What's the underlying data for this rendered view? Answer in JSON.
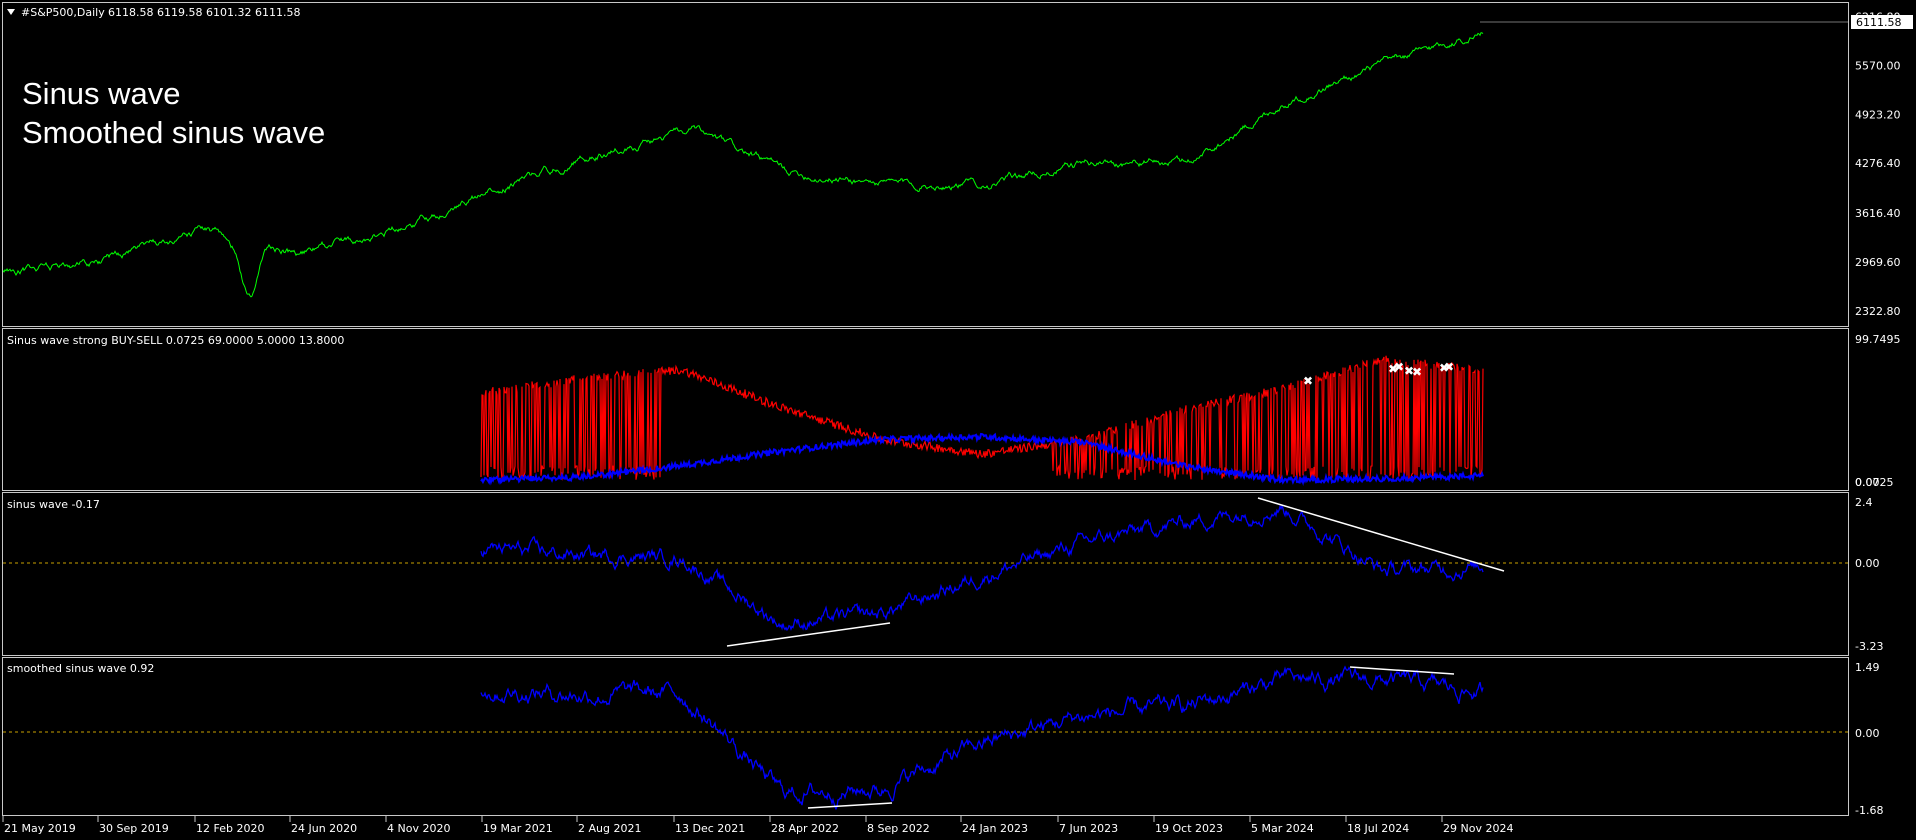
{
  "header": {
    "symbol": "#S&P500,Daily",
    "ohlc": "6118.58 6119.58 6101.32 6111.58",
    "last_price": "6111.58"
  },
  "overlay_text": [
    "Sinus wave",
    "Smoothed sinus wave"
  ],
  "colors": {
    "price_line": "#00ff00",
    "indicator_red": "#ff0000",
    "indicator_blue": "#0000ff",
    "trendline": "#ffffff",
    "zero_level": "#c8a000",
    "background": "#000000",
    "border": "#c8c8c8"
  },
  "panes": {
    "price": {
      "y_ticks": [
        "6216.80",
        "5570.00",
        "4923.20",
        "4276.40",
        "3616.40",
        "2969.60",
        "2322.80"
      ],
      "y_range": [
        2150,
        6330
      ]
    },
    "buy_sell": {
      "title": "Sinus wave strong BUY-SELL 0.0725 69.0000 5.0000 13.8000",
      "y_ticks_top": "99.7495",
      "y_ticks_bottom": "0.0725",
      "y_tick_overlap": "0.00"
    },
    "sinus": {
      "title": "sinus wave -0.17",
      "y_ticks": [
        "2.4",
        "0.00",
        "-3.23"
      ]
    },
    "smoothed": {
      "title": "smoothed sinus wave 0.92",
      "y_ticks": [
        "1.49",
        "0.00",
        "-1.68"
      ]
    }
  },
  "x_axis": {
    "dates": [
      "21 May 2019",
      "30 Sep 2019",
      "12 Feb 2020",
      "24 Jun 2020",
      "4 Nov 2020",
      "19 Mar 2021",
      "2 Aug 2021",
      "13 Dec 2021",
      "28 Apr 2022",
      "8 Sep 2022",
      "24 Jan 2023",
      "7 Jun 2023",
      "19 Oct 2023",
      "5 Mar 2024",
      "18 Jul 2024",
      "29 Nov 2024"
    ]
  },
  "chart_data": [
    {
      "type": "line",
      "title": "#S&P500,Daily",
      "x": [
        "21 May 2019",
        "30 Sep 2019",
        "12 Feb 2020",
        "24 Jun 2020",
        "4 Nov 2020",
        "19 Mar 2021",
        "2 Aug 2021",
        "13 Dec 2021",
        "28 Apr 2022",
        "8 Sep 2022",
        "24 Jan 2023",
        "7 Jun 2023",
        "19 Oct 2023",
        "5 Mar 2024",
        "18 Jul 2024",
        "29 Nov 2024"
      ],
      "series": [
        {
          "name": "#S&P500,Daily",
          "values": [
            2830,
            2980,
            3380,
            3080,
            3430,
            3920,
            4400,
            4700,
            4150,
            4000,
            4010,
            4290,
            4280,
            5090,
            5580,
            6020
          ]
        }
      ],
      "ylim": [
        2150,
        6330
      ]
    },
    {
      "type": "line",
      "title": "Sinus wave strong BUY-SELL 0.0725 69.0000 5.0000 13.8000",
      "x": [
        "19 Mar 2021",
        "2 Aug 2021",
        "13 Dec 2021",
        "28 Apr 2022",
        "8 Sep 2022",
        "24 Jan 2023",
        "7 Jun 2023",
        "19 Oct 2023",
        "5 Mar 2024",
        "18 Jul 2024",
        "29 Nov 2024"
      ],
      "series": [
        {
          "values": [
            62,
            72,
            78,
            52,
            30,
            20,
            30,
            50,
            65,
            85,
            78
          ]
        },
        {
          "values": [
            2,
            4,
            12,
            22,
            30,
            32,
            28,
            12,
            2,
            3,
            5
          ]
        }
      ],
      "ylim": [
        0.0725,
        99.7495
      ]
    },
    {
      "type": "line",
      "title": "sinus wave -0.17",
      "x": [
        "19 Mar 2021",
        "2 Aug 2021",
        "13 Dec 2021",
        "28 Apr 2022",
        "8 Sep 2022",
        "24 Jan 2023",
        "7 Jun 2023",
        "19 Oct 2023",
        "5 Mar 2024",
        "18 Jul 2024",
        "29 Nov 2024"
      ],
      "series": [
        {
          "values": [
            0.6,
            0.3,
            0.2,
            -2.4,
            -2.0,
            -0.5,
            0.8,
            1.6,
            2.2,
            -0.3,
            -0.17
          ]
        }
      ],
      "ylim": [
        -3.23,
        2.4
      ]
    },
    {
      "type": "line",
      "title": "smoothed sinus wave 0.92",
      "x": [
        "19 Mar 2021",
        "2 Aug 2021",
        "13 Dec 2021",
        "28 Apr 2022",
        "8 Sep 2022",
        "24 Jan 2023",
        "7 Jun 2023",
        "19 Oct 2023",
        "5 Mar 2024",
        "18 Jul 2024",
        "29 Nov 2024"
      ],
      "series": [
        {
          "values": [
            1.0,
            0.9,
            0.9,
            -1.3,
            -1.2,
            -0.2,
            0.4,
            0.6,
            1.2,
            1.2,
            0.92
          ]
        }
      ],
      "ylim": [
        -1.68,
        1.49
      ]
    }
  ]
}
